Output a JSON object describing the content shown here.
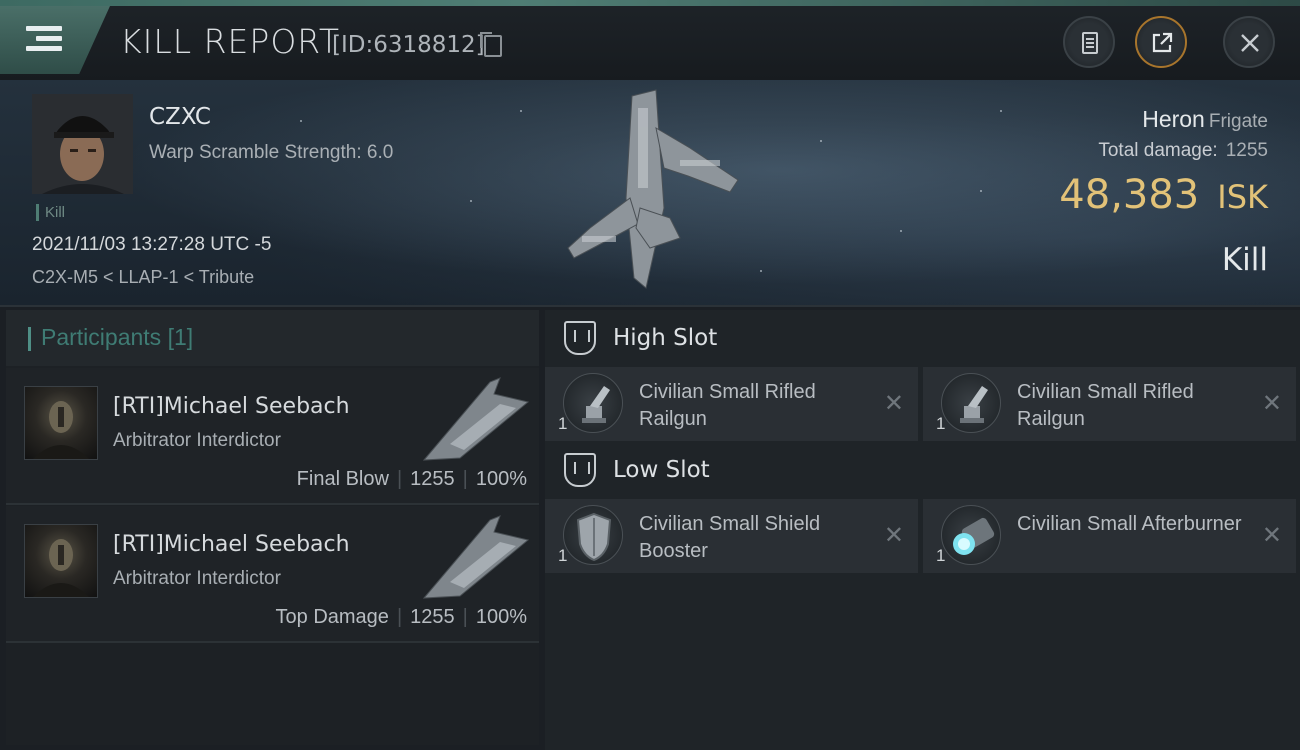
{
  "header": {
    "title": "KILL REPORT",
    "report_id": "[ID:6318812]"
  },
  "victim": {
    "name": "CZXC",
    "warp_scramble": "Warp Scramble Strength: 6.0",
    "kill_tag": "Kill",
    "datetime": "2021/11/03 13:27:28 UTC -5",
    "location": "C2X-M5 < LLAP-1 < Tribute",
    "ship_name": "Heron",
    "ship_class": "Frigate",
    "total_damage_label": "Total damage:",
    "total_damage": "1255",
    "isk_value": "48,383",
    "isk_unit": "ISK",
    "result": "Kill"
  },
  "participants": {
    "title": "Participants",
    "count": "[1]",
    "rows": [
      {
        "name": "[RTI]Michael Seebach",
        "ship": "Arbitrator Interdictor",
        "role": "Final Blow",
        "damage": "1255",
        "percent": "100%"
      },
      {
        "name": "[RTI]Michael Seebach",
        "ship": "Arbitrator Interdictor",
        "role": "Top Damage",
        "damage": "1255",
        "percent": "100%"
      }
    ]
  },
  "fittings": {
    "high_slot": {
      "title": "High Slot",
      "items": [
        {
          "name": "Civilian Small Rifled Railgun",
          "qty": "1"
        },
        {
          "name": "Civilian Small Rifled Railgun",
          "qty": "1"
        }
      ]
    },
    "low_slot": {
      "title": "Low Slot",
      "items": [
        {
          "name": "Civilian Small Shield Booster",
          "qty": "1"
        },
        {
          "name": "Civilian Small Afterburner",
          "qty": "1"
        }
      ]
    },
    "close_glyph": "✕"
  },
  "icons": [
    "menu-icon",
    "clipboard-icon",
    "share-icon",
    "close-icon",
    "copy-icon",
    "high-slot-icon",
    "low-slot-icon"
  ],
  "colors": {
    "accent": "#4f7d74",
    "isk": "#e2c278",
    "share_ring": "#a8752c"
  }
}
